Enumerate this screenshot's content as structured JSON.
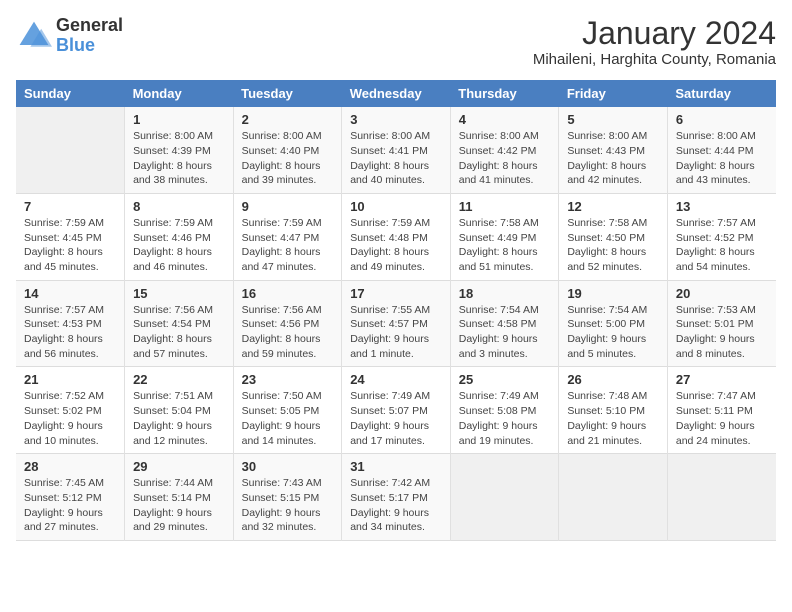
{
  "header": {
    "logo_general": "General",
    "logo_blue": "Blue",
    "title": "January 2024",
    "subtitle": "Mihaileni, Harghita County, Romania"
  },
  "calendar": {
    "weekdays": [
      "Sunday",
      "Monday",
      "Tuesday",
      "Wednesday",
      "Thursday",
      "Friday",
      "Saturday"
    ],
    "weeks": [
      [
        {
          "day": "",
          "info": ""
        },
        {
          "day": "1",
          "info": "Sunrise: 8:00 AM\nSunset: 4:39 PM\nDaylight: 8 hours\nand 38 minutes."
        },
        {
          "day": "2",
          "info": "Sunrise: 8:00 AM\nSunset: 4:40 PM\nDaylight: 8 hours\nand 39 minutes."
        },
        {
          "day": "3",
          "info": "Sunrise: 8:00 AM\nSunset: 4:41 PM\nDaylight: 8 hours\nand 40 minutes."
        },
        {
          "day": "4",
          "info": "Sunrise: 8:00 AM\nSunset: 4:42 PM\nDaylight: 8 hours\nand 41 minutes."
        },
        {
          "day": "5",
          "info": "Sunrise: 8:00 AM\nSunset: 4:43 PM\nDaylight: 8 hours\nand 42 minutes."
        },
        {
          "day": "6",
          "info": "Sunrise: 8:00 AM\nSunset: 4:44 PM\nDaylight: 8 hours\nand 43 minutes."
        }
      ],
      [
        {
          "day": "7",
          "info": "Sunrise: 7:59 AM\nSunset: 4:45 PM\nDaylight: 8 hours\nand 45 minutes."
        },
        {
          "day": "8",
          "info": "Sunrise: 7:59 AM\nSunset: 4:46 PM\nDaylight: 8 hours\nand 46 minutes."
        },
        {
          "day": "9",
          "info": "Sunrise: 7:59 AM\nSunset: 4:47 PM\nDaylight: 8 hours\nand 47 minutes."
        },
        {
          "day": "10",
          "info": "Sunrise: 7:59 AM\nSunset: 4:48 PM\nDaylight: 8 hours\nand 49 minutes."
        },
        {
          "day": "11",
          "info": "Sunrise: 7:58 AM\nSunset: 4:49 PM\nDaylight: 8 hours\nand 51 minutes."
        },
        {
          "day": "12",
          "info": "Sunrise: 7:58 AM\nSunset: 4:50 PM\nDaylight: 8 hours\nand 52 minutes."
        },
        {
          "day": "13",
          "info": "Sunrise: 7:57 AM\nSunset: 4:52 PM\nDaylight: 8 hours\nand 54 minutes."
        }
      ],
      [
        {
          "day": "14",
          "info": "Sunrise: 7:57 AM\nSunset: 4:53 PM\nDaylight: 8 hours\nand 56 minutes."
        },
        {
          "day": "15",
          "info": "Sunrise: 7:56 AM\nSunset: 4:54 PM\nDaylight: 8 hours\nand 57 minutes."
        },
        {
          "day": "16",
          "info": "Sunrise: 7:56 AM\nSunset: 4:56 PM\nDaylight: 8 hours\nand 59 minutes."
        },
        {
          "day": "17",
          "info": "Sunrise: 7:55 AM\nSunset: 4:57 PM\nDaylight: 9 hours\nand 1 minute."
        },
        {
          "day": "18",
          "info": "Sunrise: 7:54 AM\nSunset: 4:58 PM\nDaylight: 9 hours\nand 3 minutes."
        },
        {
          "day": "19",
          "info": "Sunrise: 7:54 AM\nSunset: 5:00 PM\nDaylight: 9 hours\nand 5 minutes."
        },
        {
          "day": "20",
          "info": "Sunrise: 7:53 AM\nSunset: 5:01 PM\nDaylight: 9 hours\nand 8 minutes."
        }
      ],
      [
        {
          "day": "21",
          "info": "Sunrise: 7:52 AM\nSunset: 5:02 PM\nDaylight: 9 hours\nand 10 minutes."
        },
        {
          "day": "22",
          "info": "Sunrise: 7:51 AM\nSunset: 5:04 PM\nDaylight: 9 hours\nand 12 minutes."
        },
        {
          "day": "23",
          "info": "Sunrise: 7:50 AM\nSunset: 5:05 PM\nDaylight: 9 hours\nand 14 minutes."
        },
        {
          "day": "24",
          "info": "Sunrise: 7:49 AM\nSunset: 5:07 PM\nDaylight: 9 hours\nand 17 minutes."
        },
        {
          "day": "25",
          "info": "Sunrise: 7:49 AM\nSunset: 5:08 PM\nDaylight: 9 hours\nand 19 minutes."
        },
        {
          "day": "26",
          "info": "Sunrise: 7:48 AM\nSunset: 5:10 PM\nDaylight: 9 hours\nand 21 minutes."
        },
        {
          "day": "27",
          "info": "Sunrise: 7:47 AM\nSunset: 5:11 PM\nDaylight: 9 hours\nand 24 minutes."
        }
      ],
      [
        {
          "day": "28",
          "info": "Sunrise: 7:45 AM\nSunset: 5:12 PM\nDaylight: 9 hours\nand 27 minutes."
        },
        {
          "day": "29",
          "info": "Sunrise: 7:44 AM\nSunset: 5:14 PM\nDaylight: 9 hours\nand 29 minutes."
        },
        {
          "day": "30",
          "info": "Sunrise: 7:43 AM\nSunset: 5:15 PM\nDaylight: 9 hours\nand 32 minutes."
        },
        {
          "day": "31",
          "info": "Sunrise: 7:42 AM\nSunset: 5:17 PM\nDaylight: 9 hours\nand 34 minutes."
        },
        {
          "day": "",
          "info": ""
        },
        {
          "day": "",
          "info": ""
        },
        {
          "day": "",
          "info": ""
        }
      ]
    ]
  }
}
